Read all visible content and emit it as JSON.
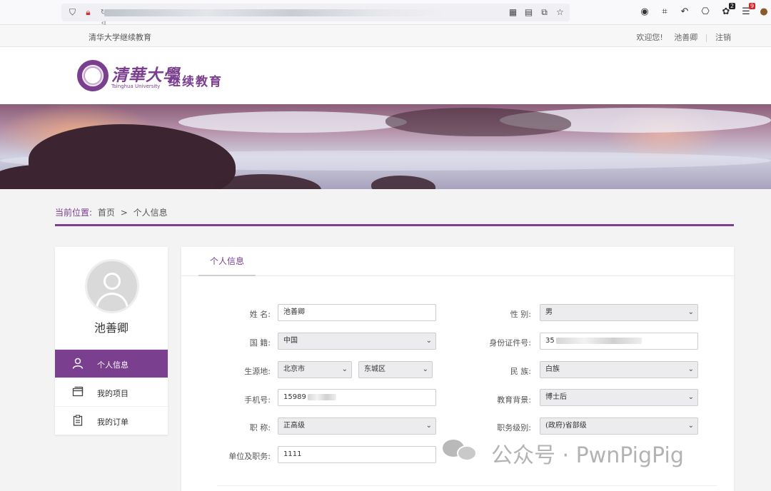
{
  "browser": {
    "url_prefix": "↻ ‹ı",
    "toolbar_icons": [
      "qr-icon",
      "reader-icon",
      "translate-icon",
      "star-icon",
      "account-icon",
      "crop-icon",
      "undo-icon",
      "extensions-icon",
      "ext-badge-icon",
      "ext-badge2-icon",
      "cookie-icon"
    ],
    "badge_1": "2",
    "badge_2": "9"
  },
  "topbar": {
    "site_name": "清华大学继续教育",
    "welcome": "欢迎您!",
    "user": "池善卿",
    "logout": "注销"
  },
  "header": {
    "logo_cn": "清華大學",
    "logo_en": "Tsinghua University",
    "logo_sub": "继续教育"
  },
  "breadcrumb": {
    "label": "当前位置:",
    "home": "首页",
    "separator": ">",
    "current": "个人信息"
  },
  "sidebar": {
    "user_name": "池善卿",
    "items": [
      {
        "label": "个人信息",
        "icon": "user-icon",
        "active": true
      },
      {
        "label": "我的项目",
        "icon": "projects-icon",
        "active": false
      },
      {
        "label": "我的订单",
        "icon": "orders-icon",
        "active": false
      }
    ]
  },
  "panel": {
    "tab": "个人信息"
  },
  "form": {
    "name_label": "姓 名:",
    "name_value": "池善卿",
    "gender_label": "性 别:",
    "gender_value": "男",
    "nationality_label": "国 籍:",
    "nationality_value": "中国",
    "id_label": "身份证件号:",
    "id_value": "35",
    "origin_label": "生源地:",
    "province_value": "北京市",
    "district_value": "东城区",
    "ethnicity_label": "民 族:",
    "ethnicity_value": "白族",
    "phone_label": "手机号:",
    "phone_value": "15989",
    "education_label": "教育背景:",
    "education_value": "博士后",
    "title_label": "职 称:",
    "title_value": "正高级",
    "level_label": "职务级别:",
    "level_value": "(政府)省部级",
    "unit_label": "单位及职务:",
    "unit_value": "1111"
  },
  "watermark": {
    "text": "公众号 · PwnPigPig"
  },
  "colors": {
    "brand_purple": "#7a3f8f"
  }
}
